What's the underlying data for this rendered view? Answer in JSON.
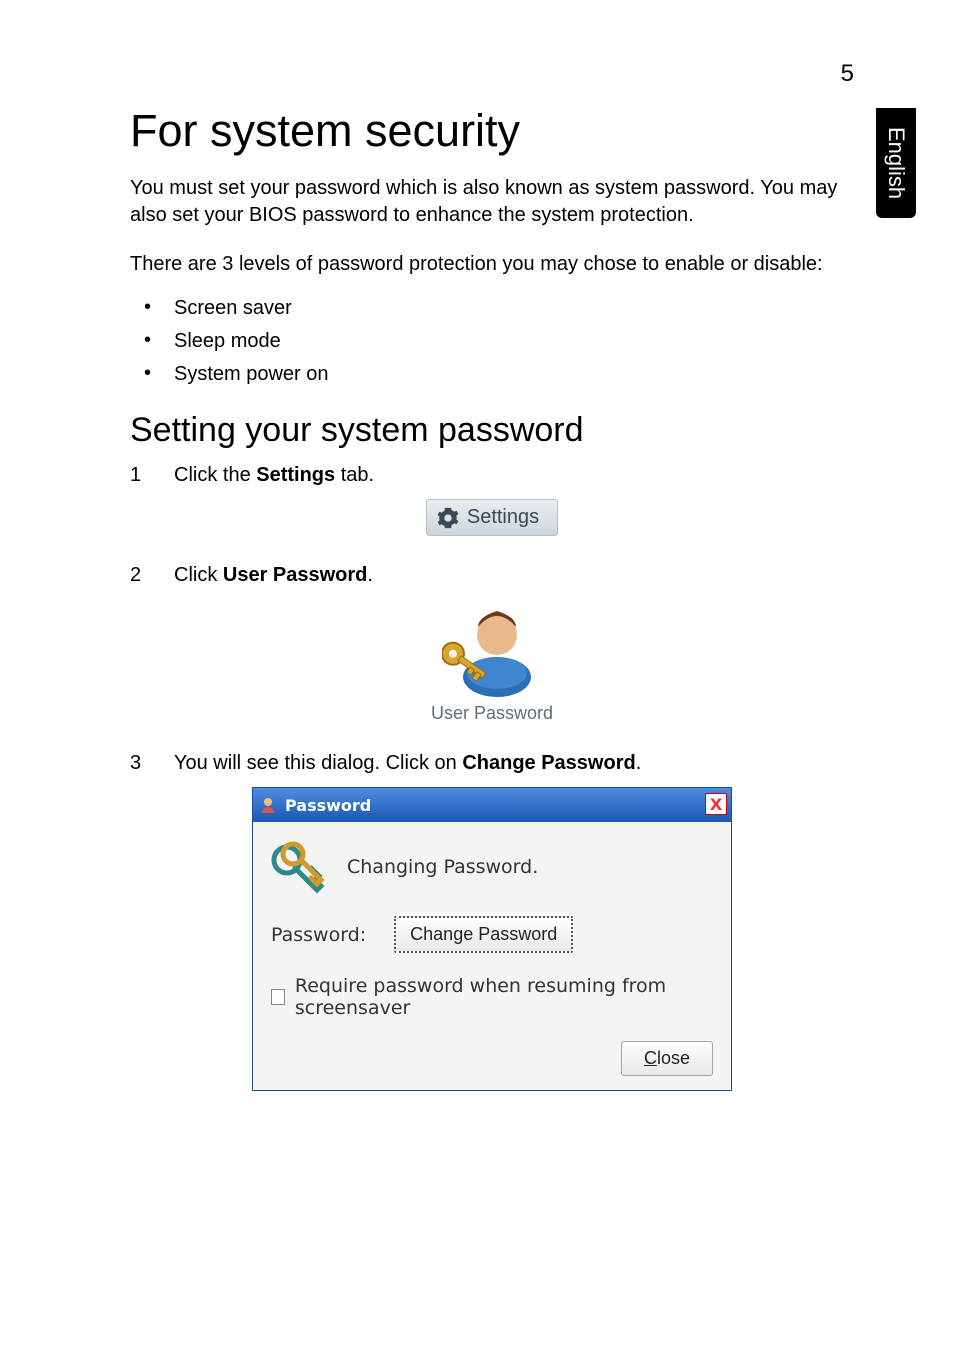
{
  "page_number": "5",
  "side_tab": "English",
  "h1": "For system security",
  "para_intro": "You must set your password which is also known as system password. You may also set your BIOS password to enhance the system protection.",
  "para_levels": "There are 3 levels of password protection you may chose to enable or disable:",
  "bullets": [
    "Screen saver",
    "Sleep mode",
    "System power on"
  ],
  "h2": "Setting your system password",
  "steps": {
    "s1": {
      "num": "1",
      "pre": "Click the ",
      "bold": "Settings",
      "post": " tab."
    },
    "s2": {
      "num": "2",
      "pre": "Click ",
      "bold": "User Password",
      "post": "."
    },
    "s3": {
      "num": "3",
      "pre": "You will see this dialog. Click on ",
      "bold": "Change Password",
      "post": "."
    }
  },
  "settings_pill": {
    "label": "Settings"
  },
  "userpw": {
    "label": "User Password"
  },
  "dialog": {
    "title": "Password",
    "close_x": "X",
    "heading": "Changing Password.",
    "pw_label": "Password:",
    "change_btn": "Change Password",
    "checkbox_label": "Require password when resuming from screensaver",
    "close_btn_pre": "C",
    "close_btn_rest": "lose"
  }
}
